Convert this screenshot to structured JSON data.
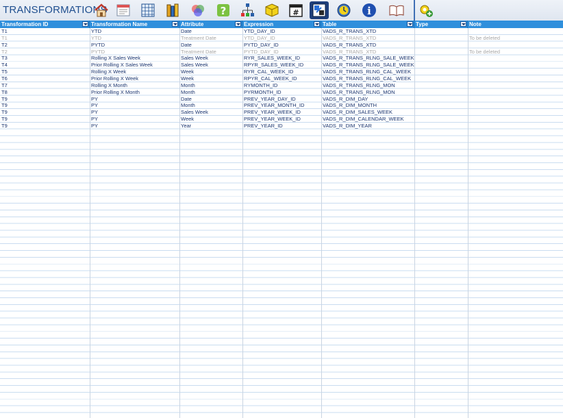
{
  "header": {
    "title": "TRANSFORMATIONS"
  },
  "toolbar": {
    "icons": [
      "home-icon",
      "table-report-icon",
      "grid-icon",
      "books-icon",
      "venn-icon",
      "help-icon",
      "hierarchy-icon",
      "cube-icon",
      "calendar-number-icon",
      "transform-icon",
      "clock-icon",
      "info-icon",
      "book-open-icon",
      "settings-add-icon"
    ]
  },
  "columns": [
    "Transformation ID",
    "Transformation Name",
    "Attribute",
    "Expression",
    "Table",
    "Type",
    "Note"
  ],
  "rows": [
    {
      "id": "T1",
      "name": "YTD",
      "attribute": "Date",
      "expression": "YTD_DAY_ID",
      "table": "VADS_R_TRANS_XTD",
      "type": "",
      "note": "",
      "deleted": false
    },
    {
      "id": "T1",
      "name": "YTD",
      "attribute": "Treatment Date",
      "expression": "YTD_DAY_ID",
      "table": "VADS_R_TRANS_XTD",
      "type": "",
      "note": "To be deleted",
      "deleted": true
    },
    {
      "id": "T2",
      "name": "PYTD",
      "attribute": "Date",
      "expression": "PYTD_DAY_ID",
      "table": "VADS_R_TRANS_XTD",
      "type": "",
      "note": "",
      "deleted": false
    },
    {
      "id": "T2",
      "name": "PYTD",
      "attribute": "Treatment Date",
      "expression": "PYTD_DAY_ID",
      "table": "VADS_R_TRANS_XTD",
      "type": "",
      "note": "To be deleted",
      "deleted": true
    },
    {
      "id": "T3",
      "name": "Rolling X Sales Week",
      "attribute": "Sales Week",
      "expression": "RYR_SALES_WEEK_ID",
      "table": "VADS_R_TRANS_RLNG_SALE_WEEK",
      "type": "",
      "note": "",
      "deleted": false
    },
    {
      "id": "T4",
      "name": "Prior Rolling X Sales Week",
      "attribute": "Sales Week",
      "expression": "RPYR_SALES_WEEK_ID",
      "table": "VADS_R_TRANS_RLNG_SALE_WEEK",
      "type": "",
      "note": "",
      "deleted": false
    },
    {
      "id": "T5",
      "name": "Rolling X Week",
      "attribute": "Week",
      "expression": "RYR_CAL_WEEK_ID",
      "table": "VADS_R_TRANS_RLNG_CAL_WEEK",
      "type": "",
      "note": "",
      "deleted": false
    },
    {
      "id": "T6",
      "name": "Prior Rolling X Week",
      "attribute": "Week",
      "expression": "RPYR_CAL_WEEK_ID",
      "table": "VADS_R_TRANS_RLNG_CAL_WEEK",
      "type": "",
      "note": "",
      "deleted": false
    },
    {
      "id": "T7",
      "name": "Rolling X Month",
      "attribute": "Month",
      "expression": "RYMONTH_ID",
      "table": "VADS_R_TRANS_RLNG_MON",
      "type": "",
      "note": "",
      "deleted": false
    },
    {
      "id": "T8",
      "name": "Prior Rolling X Month",
      "attribute": "Month",
      "expression": "PYRMONTH_ID",
      "table": "VADS_R_TRANS_RLNG_MON",
      "type": "",
      "note": "",
      "deleted": false
    },
    {
      "id": "T9",
      "name": "PY",
      "attribute": "Date",
      "expression": "PREV_YEAR_DAY_ID",
      "table": "VADS_R_DIM_DAY",
      "type": "",
      "note": "",
      "deleted": false
    },
    {
      "id": "T9",
      "name": "PY",
      "attribute": "Month",
      "expression": "PREV_YEAR_MONTH_ID",
      "table": "VADS_R_DIM_MONTH",
      "type": "",
      "note": "",
      "deleted": false
    },
    {
      "id": "T9",
      "name": "PY",
      "attribute": "Sales Week",
      "expression": "PREV_YEAR_WEEK_ID",
      "table": "VADS_R_DIM_SALES_WEEK",
      "type": "",
      "note": "",
      "deleted": false
    },
    {
      "id": "T9",
      "name": "PY",
      "attribute": "Week",
      "expression": "PREV_YEAR_WEEK_ID",
      "table": "VADS_R_DIM_CALENDAR_WEEK",
      "type": "",
      "note": "",
      "deleted": false
    },
    {
      "id": "T9",
      "name": "PY",
      "attribute": "Year",
      "expression": "PREV_YEAR_ID",
      "table": "VADS_R_DIM_YEAR",
      "type": "",
      "note": "",
      "deleted": false
    }
  ]
}
